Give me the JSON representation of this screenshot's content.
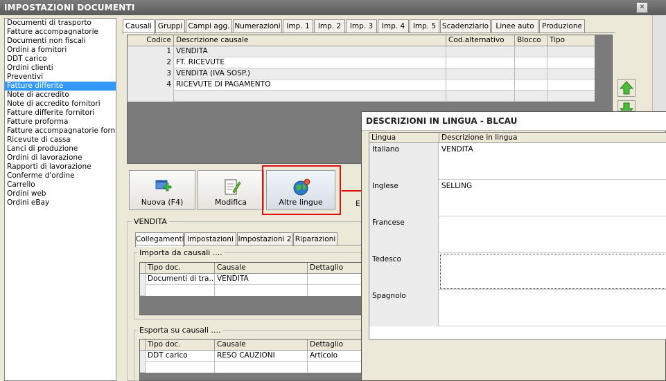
{
  "main": {
    "title": "IMPOSTAZIONI DOCUMENTI",
    "close_glyph": "✕"
  },
  "doc_list": [
    "Documenti di trasporto",
    "Fatture accompagnatorie",
    "Documenti non fiscali",
    "Ordini a fornitori",
    "DDT carico",
    "Ordini clienti",
    "Preventivi",
    "Fatture differite",
    "Note di accredito",
    "Note di accredito fornitori",
    "Fatture differite fornitori",
    "Fatture proforma",
    "Fatture accompagnatorie fornito",
    "Ricevute di cassa",
    "Lanci di produzione",
    "Ordini di lavorazione",
    "Rapporti di lavorazione",
    "Conferme d'ordine",
    "Carrello",
    "Ordini web",
    "Ordini eBay"
  ],
  "selected_doc_index": 7,
  "tabs": [
    "Causali",
    "Gruppi",
    "Campi agg.",
    "Numerazioni",
    "Imp. 1",
    "Imp. 2",
    "Imp. 3",
    "Imp. 4",
    "Imp. 5",
    "Scadenziario",
    "Linee auto",
    "Produzione"
  ],
  "causali": {
    "headers": [
      "Codice",
      "Descrizione causale",
      "Cod.alternativo",
      "Blocco",
      "Tipo"
    ],
    "rows": [
      {
        "code": "1",
        "desc": "VENDITA"
      },
      {
        "code": "2",
        "desc": "FT. RICEVUTE"
      },
      {
        "code": "3",
        "desc": "VENDITA (IVA SOSP.)"
      },
      {
        "code": "4",
        "desc": "RICEVUTE DI PAGAMENTO"
      }
    ]
  },
  "toolbar": {
    "new_label": "Nuova (F4)",
    "edit_label": "Modifica",
    "languages_label": "Altre lingue",
    "partial_label": "E"
  },
  "detail": {
    "group_title": "VENDITA",
    "subtabs": [
      "Collegamenti",
      "Impostazioni",
      "Impostazioni 2",
      "Riparazioni"
    ],
    "import_title": "Importa da causali ....",
    "export_title": "Esporta su causali ....",
    "headers": [
      "Tipo doc.",
      "Causale",
      "Dettaglio"
    ],
    "import_rows": [
      {
        "tipo": "Documenti di tra...",
        "causale": "VENDITA",
        "dettaglio": ""
      }
    ],
    "export_rows": [
      {
        "tipo": "DDT carico",
        "causale": "RESO CAUZIONI",
        "dettaglio": "Articolo"
      }
    ]
  },
  "lingue": {
    "title": "DESCRIZIONI IN LINGUA - BLCAU",
    "headers": [
      "Lingua",
      "Descrizione in lingua"
    ],
    "rows": [
      {
        "lang": "Italiano",
        "desc": "VENDITA"
      },
      {
        "lang": "Inglese",
        "desc": "SELLING"
      },
      {
        "lang": "Francese",
        "desc": ""
      },
      {
        "lang": "Tedesco",
        "desc": ""
      },
      {
        "lang": "Spagnolo",
        "desc": ""
      }
    ]
  },
  "colors": {
    "highlight": "#e01010",
    "selection": "#3399ff"
  }
}
